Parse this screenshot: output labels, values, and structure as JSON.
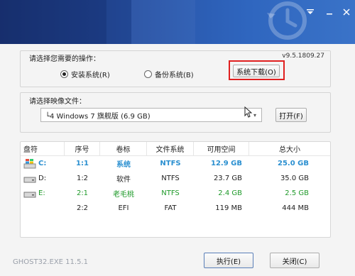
{
  "window": {
    "footer_title": "GHOST32.EXE 11.5.1"
  },
  "operation": {
    "title": "请选择您需要的操作：",
    "version": "v9.5.1809.27",
    "radio_install": "安装系统(R)",
    "radio_backup": "备份系统(B)",
    "selected": "install",
    "download_button": "系统下载(O)"
  },
  "image": {
    "title": "请选择映像文件：",
    "selected_value": "└4 Windows 7 旗舰版 (6.9 GB)",
    "open_button": "打开(F)"
  },
  "table": {
    "headers": [
      "盘符",
      "序号",
      "卷标",
      "文件系统",
      "可用空间",
      "总大小"
    ],
    "rows": [
      {
        "drive": "C:",
        "icon": "windows-drive-icon",
        "index": "1:1",
        "label": "系统",
        "fs": "NTFS",
        "free": "12.9 GB",
        "total": "25.0 GB",
        "style": "blue"
      },
      {
        "drive": "D:",
        "icon": "drive-icon",
        "index": "1:2",
        "label": "软件",
        "fs": "NTFS",
        "free": "23.7 GB",
        "total": "35.0 GB",
        "style": "normal"
      },
      {
        "drive": "E:",
        "icon": "drive-icon",
        "index": "2:1",
        "label": "老毛桃",
        "fs": "NTFS",
        "free": "2.4 GB",
        "total": "2.5 GB",
        "style": "green"
      },
      {
        "drive": "",
        "icon": "",
        "index": "2:2",
        "label": "EFI",
        "fs": "FAT",
        "free": "119 MB",
        "total": "444 MB",
        "style": "normal"
      }
    ]
  },
  "buttons": {
    "execute": "执行(E)",
    "close": "关闭(C)"
  },
  "colors": {
    "highlight_box": "#e02020",
    "system_row": "#2a8fd0",
    "usb_row": "#1f9a2a"
  }
}
